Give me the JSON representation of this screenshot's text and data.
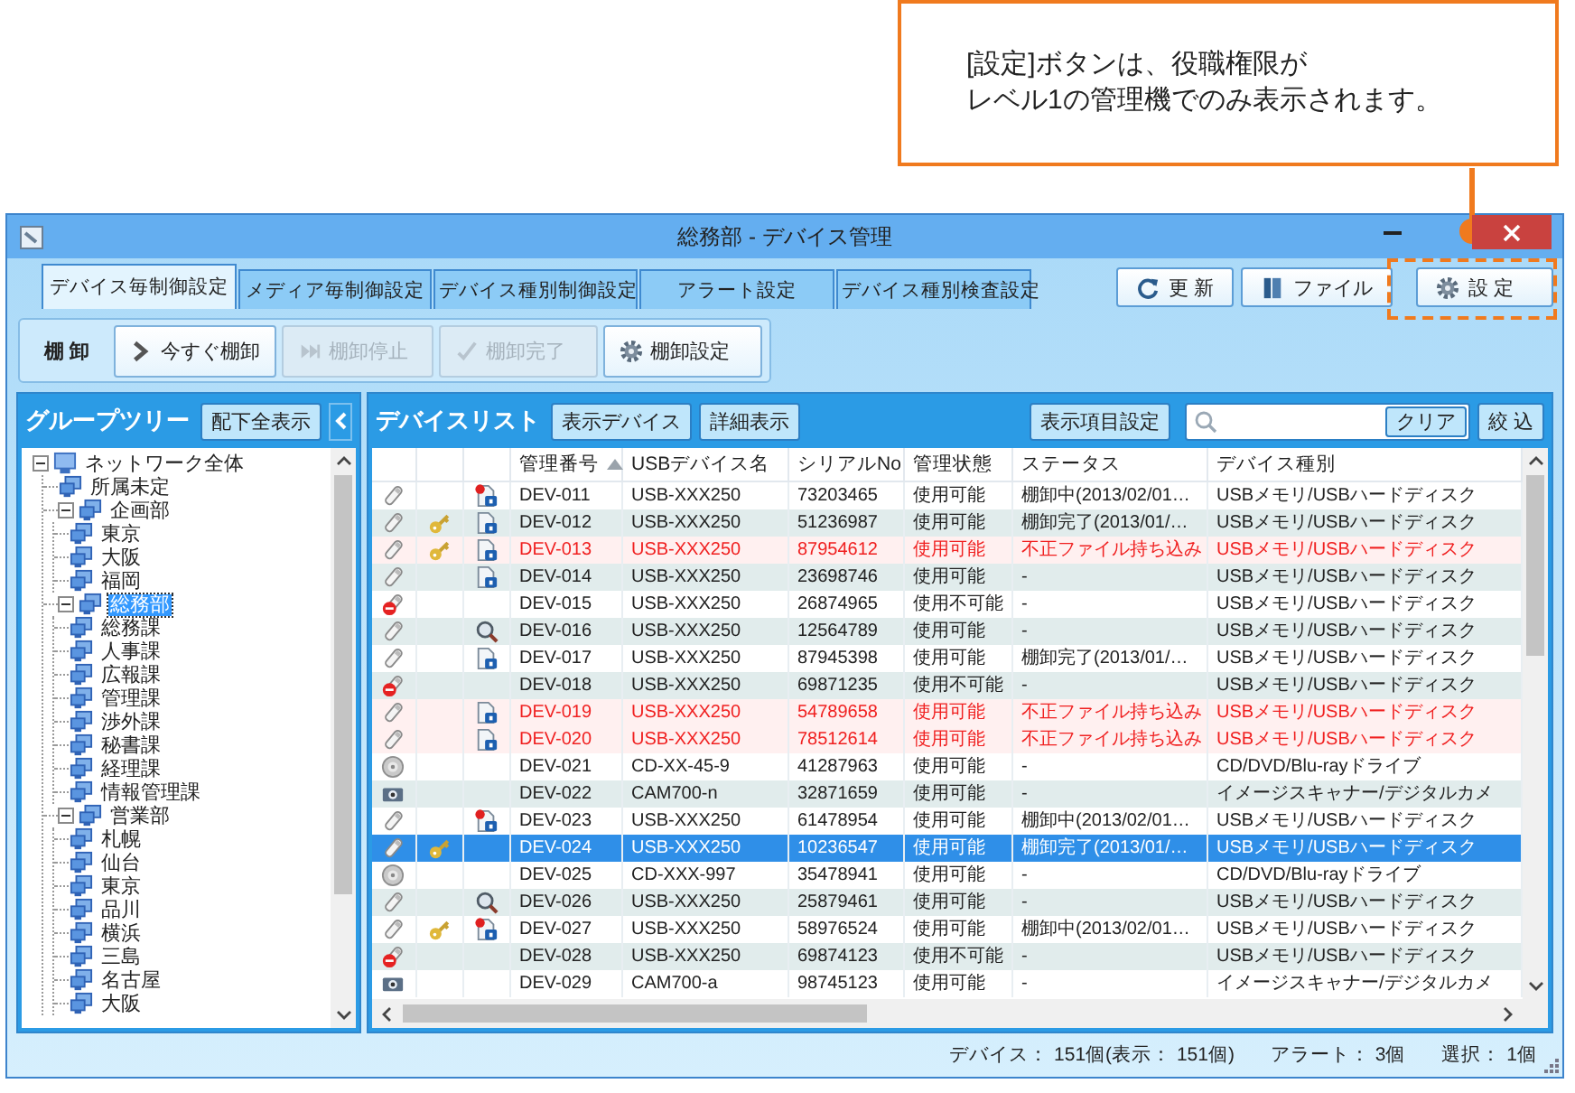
{
  "callout": {
    "lines": [
      "[設定]ボタンは、役職権限が",
      "レベル1の管理機でのみ表示されます。"
    ]
  },
  "window": {
    "title": "総務部 - デバイス管理"
  },
  "tabs": [
    {
      "label": "デバイス毎制御設定",
      "selected": true
    },
    {
      "label": "メディア毎制御設定",
      "selected": false
    },
    {
      "label": "デバイス種別制御設定",
      "selected": false
    },
    {
      "label": "アラート設定",
      "selected": false
    },
    {
      "label": "デバイス種別検査設定",
      "selected": false
    }
  ],
  "header_buttons": [
    "更 新",
    "ファイル",
    "設 定"
  ],
  "toolbar": {
    "label": "棚 卸",
    "buttons": [
      {
        "label": "今すぐ棚卸",
        "disabled": false
      },
      {
        "label": "棚卸停止",
        "disabled": true
      },
      {
        "label": "棚卸完了",
        "disabled": true
      },
      {
        "label": "棚卸設定",
        "disabled": false
      }
    ]
  },
  "tree_panel": {
    "title": "グループツリー",
    "button": "配下全表示",
    "items": [
      {
        "label": "ネットワーク全体",
        "kind": "computer",
        "expanded": true,
        "selected": false,
        "children": [
          {
            "label": "所属未定",
            "kind": "group",
            "selected": false
          },
          {
            "label": "企画部",
            "kind": "group",
            "expanded": true,
            "selected": false,
            "children": [
              {
                "label": "東京",
                "kind": "group",
                "selected": false
              },
              {
                "label": "大阪",
                "kind": "group",
                "selected": false
              },
              {
                "label": "福岡",
                "kind": "group",
                "selected": false
              }
            ]
          },
          {
            "label": "総務部",
            "kind": "group",
            "expanded": true,
            "selected": true,
            "children": [
              {
                "label": "総務課",
                "kind": "group",
                "selected": false
              },
              {
                "label": "人事課",
                "kind": "group",
                "selected": false
              },
              {
                "label": "広報課",
                "kind": "group",
                "selected": false
              },
              {
                "label": "管理課",
                "kind": "group",
                "selected": false
              },
              {
                "label": "渉外課",
                "kind": "group",
                "selected": false
              },
              {
                "label": "秘書課",
                "kind": "group",
                "selected": false
              },
              {
                "label": "経理課",
                "kind": "group",
                "selected": false
              },
              {
                "label": "情報管理課",
                "kind": "group",
                "selected": false
              }
            ]
          },
          {
            "label": "営業部",
            "kind": "group",
            "expanded": true,
            "selected": false,
            "children": [
              {
                "label": "札幌",
                "kind": "group",
                "selected": false
              },
              {
                "label": "仙台",
                "kind": "group",
                "selected": false
              },
              {
                "label": "東京",
                "kind": "group",
                "selected": false
              },
              {
                "label": "品川",
                "kind": "group",
                "selected": false
              },
              {
                "label": "横浜",
                "kind": "group",
                "selected": false
              },
              {
                "label": "三島",
                "kind": "group",
                "selected": false
              },
              {
                "label": "名古屋",
                "kind": "group",
                "selected": false
              },
              {
                "label": "大阪",
                "kind": "group",
                "selected": false
              }
            ]
          }
        ]
      }
    ]
  },
  "device_panel": {
    "title": "デバイスリスト",
    "buttons": [
      "表示デバイス",
      "詳細表示"
    ],
    "settings_button": "表示項目設定",
    "clear_button": "クリア",
    "filter_button": "絞 込",
    "columns": [
      {
        "label": "管理番号",
        "sorted": true
      },
      {
        "label": "USBデバイス名",
        "sorted": false
      },
      {
        "label": "シリアルNo",
        "sorted": false
      },
      {
        "label": "管理状態",
        "sorted": false
      },
      {
        "label": "ステータス",
        "sorted": false
      },
      {
        "label": "デバイス種別",
        "sorted": false
      }
    ],
    "rows": [
      {
        "kind": "usb",
        "key": false,
        "locked": true,
        "flagged": true,
        "inspecting": false,
        "id": "DEV-011",
        "name": "USB-XXX250",
        "serial": "73203465",
        "state": "使用可能",
        "status": "棚卸中(2013/02/01…",
        "type": "USBメモリ/USBハードディスク",
        "alert": false,
        "selected": false
      },
      {
        "kind": "usb",
        "key": true,
        "locked": true,
        "flagged": false,
        "inspecting": false,
        "id": "DEV-012",
        "name": "USB-XXX250",
        "serial": "51236987",
        "state": "使用可能",
        "status": "棚卸完了(2013/01/…",
        "type": "USBメモリ/USBハードディスク",
        "alert": false,
        "selected": false
      },
      {
        "kind": "usb",
        "key": true,
        "locked": true,
        "flagged": false,
        "inspecting": false,
        "id": "DEV-013",
        "name": "USB-XXX250",
        "serial": "87954612",
        "state": "使用可能",
        "status": "不正ファイル持ち込み",
        "type": "USBメモリ/USBハードディスク",
        "alert": true,
        "selected": false
      },
      {
        "kind": "usb",
        "key": false,
        "locked": true,
        "flagged": false,
        "inspecting": false,
        "id": "DEV-014",
        "name": "USB-XXX250",
        "serial": "23698746",
        "state": "使用可能",
        "status": "-",
        "type": "USBメモリ/USBハードディスク",
        "alert": false,
        "selected": false
      },
      {
        "kind": "blocked",
        "key": false,
        "locked": false,
        "flagged": false,
        "inspecting": false,
        "id": "DEV-015",
        "name": "USB-XXX250",
        "serial": "26874965",
        "state": "使用不可能",
        "status": "-",
        "type": "USBメモリ/USBハードディスク",
        "alert": false,
        "selected": false
      },
      {
        "kind": "usb",
        "key": false,
        "locked": false,
        "flagged": false,
        "inspecting": true,
        "id": "DEV-016",
        "name": "USB-XXX250",
        "serial": "12564789",
        "state": "使用可能",
        "status": "-",
        "type": "USBメモリ/USBハードディスク",
        "alert": false,
        "selected": false
      },
      {
        "kind": "usb",
        "key": false,
        "locked": true,
        "flagged": false,
        "inspecting": false,
        "id": "DEV-017",
        "name": "USB-XXX250",
        "serial": "87945398",
        "state": "使用可能",
        "status": "棚卸完了(2013/01/…",
        "type": "USBメモリ/USBハードディスク",
        "alert": false,
        "selected": false
      },
      {
        "kind": "blocked",
        "key": false,
        "locked": false,
        "flagged": false,
        "inspecting": false,
        "id": "DEV-018",
        "name": "USB-XXX250",
        "serial": "69871235",
        "state": "使用不可能",
        "status": "-",
        "type": "USBメモリ/USBハードディスク",
        "alert": false,
        "selected": false
      },
      {
        "kind": "usb",
        "key": false,
        "locked": true,
        "flagged": false,
        "inspecting": false,
        "id": "DEV-019",
        "name": "USB-XXX250",
        "serial": "54789658",
        "state": "使用可能",
        "status": "不正ファイル持ち込み",
        "type": "USBメモリ/USBハードディスク",
        "alert": true,
        "selected": false
      },
      {
        "kind": "usb",
        "key": false,
        "locked": true,
        "flagged": false,
        "inspecting": false,
        "id": "DEV-020",
        "name": "USB-XXX250",
        "serial": "78512614",
        "state": "使用可能",
        "status": "不正ファイル持ち込み",
        "type": "USBメモリ/USBハードディスク",
        "alert": true,
        "selected": false
      },
      {
        "kind": "cd",
        "key": false,
        "locked": false,
        "flagged": false,
        "inspecting": false,
        "id": "DEV-021",
        "name": "CD-XX-45-9",
        "serial": "41287963",
        "state": "使用可能",
        "status": "-",
        "type": "CD/DVD/Blu-rayドライブ",
        "alert": false,
        "selected": false
      },
      {
        "kind": "camera",
        "key": false,
        "locked": false,
        "flagged": false,
        "inspecting": false,
        "id": "DEV-022",
        "name": "CAM700-n",
        "serial": "32871659",
        "state": "使用可能",
        "status": "-",
        "type": "イメージスキャナー/デジタルカメ",
        "alert": false,
        "selected": false
      },
      {
        "kind": "usb",
        "key": false,
        "locked": true,
        "flagged": true,
        "inspecting": false,
        "id": "DEV-023",
        "name": "USB-XXX250",
        "serial": "61478954",
        "state": "使用可能",
        "status": "棚卸中(2013/02/01…",
        "type": "USBメモリ/USBハードディスク",
        "alert": false,
        "selected": false
      },
      {
        "kind": "usb",
        "key": true,
        "locked": false,
        "flagged": false,
        "inspecting": false,
        "id": "DEV-024",
        "name": "USB-XXX250",
        "serial": "10236547",
        "state": "使用可能",
        "status": "棚卸完了(2013/01/…",
        "type": "USBメモリ/USBハードディスク",
        "alert": false,
        "selected": true
      },
      {
        "kind": "cd",
        "key": false,
        "locked": false,
        "flagged": false,
        "inspecting": false,
        "id": "DEV-025",
        "name": "CD-XXX-997",
        "serial": "35478941",
        "state": "使用可能",
        "status": "-",
        "type": "CD/DVD/Blu-rayドライブ",
        "alert": false,
        "selected": false
      },
      {
        "kind": "usb",
        "key": false,
        "locked": false,
        "flagged": false,
        "inspecting": true,
        "id": "DEV-026",
        "name": "USB-XXX250",
        "serial": "25879461",
        "state": "使用可能",
        "status": "-",
        "type": "USBメモリ/USBハードディスク",
        "alert": false,
        "selected": false
      },
      {
        "kind": "usb",
        "key": true,
        "locked": true,
        "flagged": true,
        "inspecting": false,
        "id": "DEV-027",
        "name": "USB-XXX250",
        "serial": "58976524",
        "state": "使用可能",
        "status": "棚卸中(2013/02/01…",
        "type": "USBメモリ/USBハードディスク",
        "alert": false,
        "selected": false
      },
      {
        "kind": "blocked",
        "key": false,
        "locked": false,
        "flagged": false,
        "inspecting": false,
        "id": "DEV-028",
        "name": "USB-XXX250",
        "serial": "69874123",
        "state": "使用不可能",
        "status": "-",
        "type": "USBメモリ/USBハードディスク",
        "alert": false,
        "selected": false
      },
      {
        "kind": "camera",
        "key": false,
        "locked": false,
        "flagged": false,
        "inspecting": false,
        "id": "DEV-029",
        "name": "CAM700-a",
        "serial": "98745123",
        "state": "使用可能",
        "status": "-",
        "type": "イメージスキャナー/デジタルカメ",
        "alert": false,
        "selected": false
      }
    ]
  },
  "status_bar": [
    "デバイス： 151個(表示： 151個)",
    "アラート： 3個",
    "選択： 1個"
  ]
}
